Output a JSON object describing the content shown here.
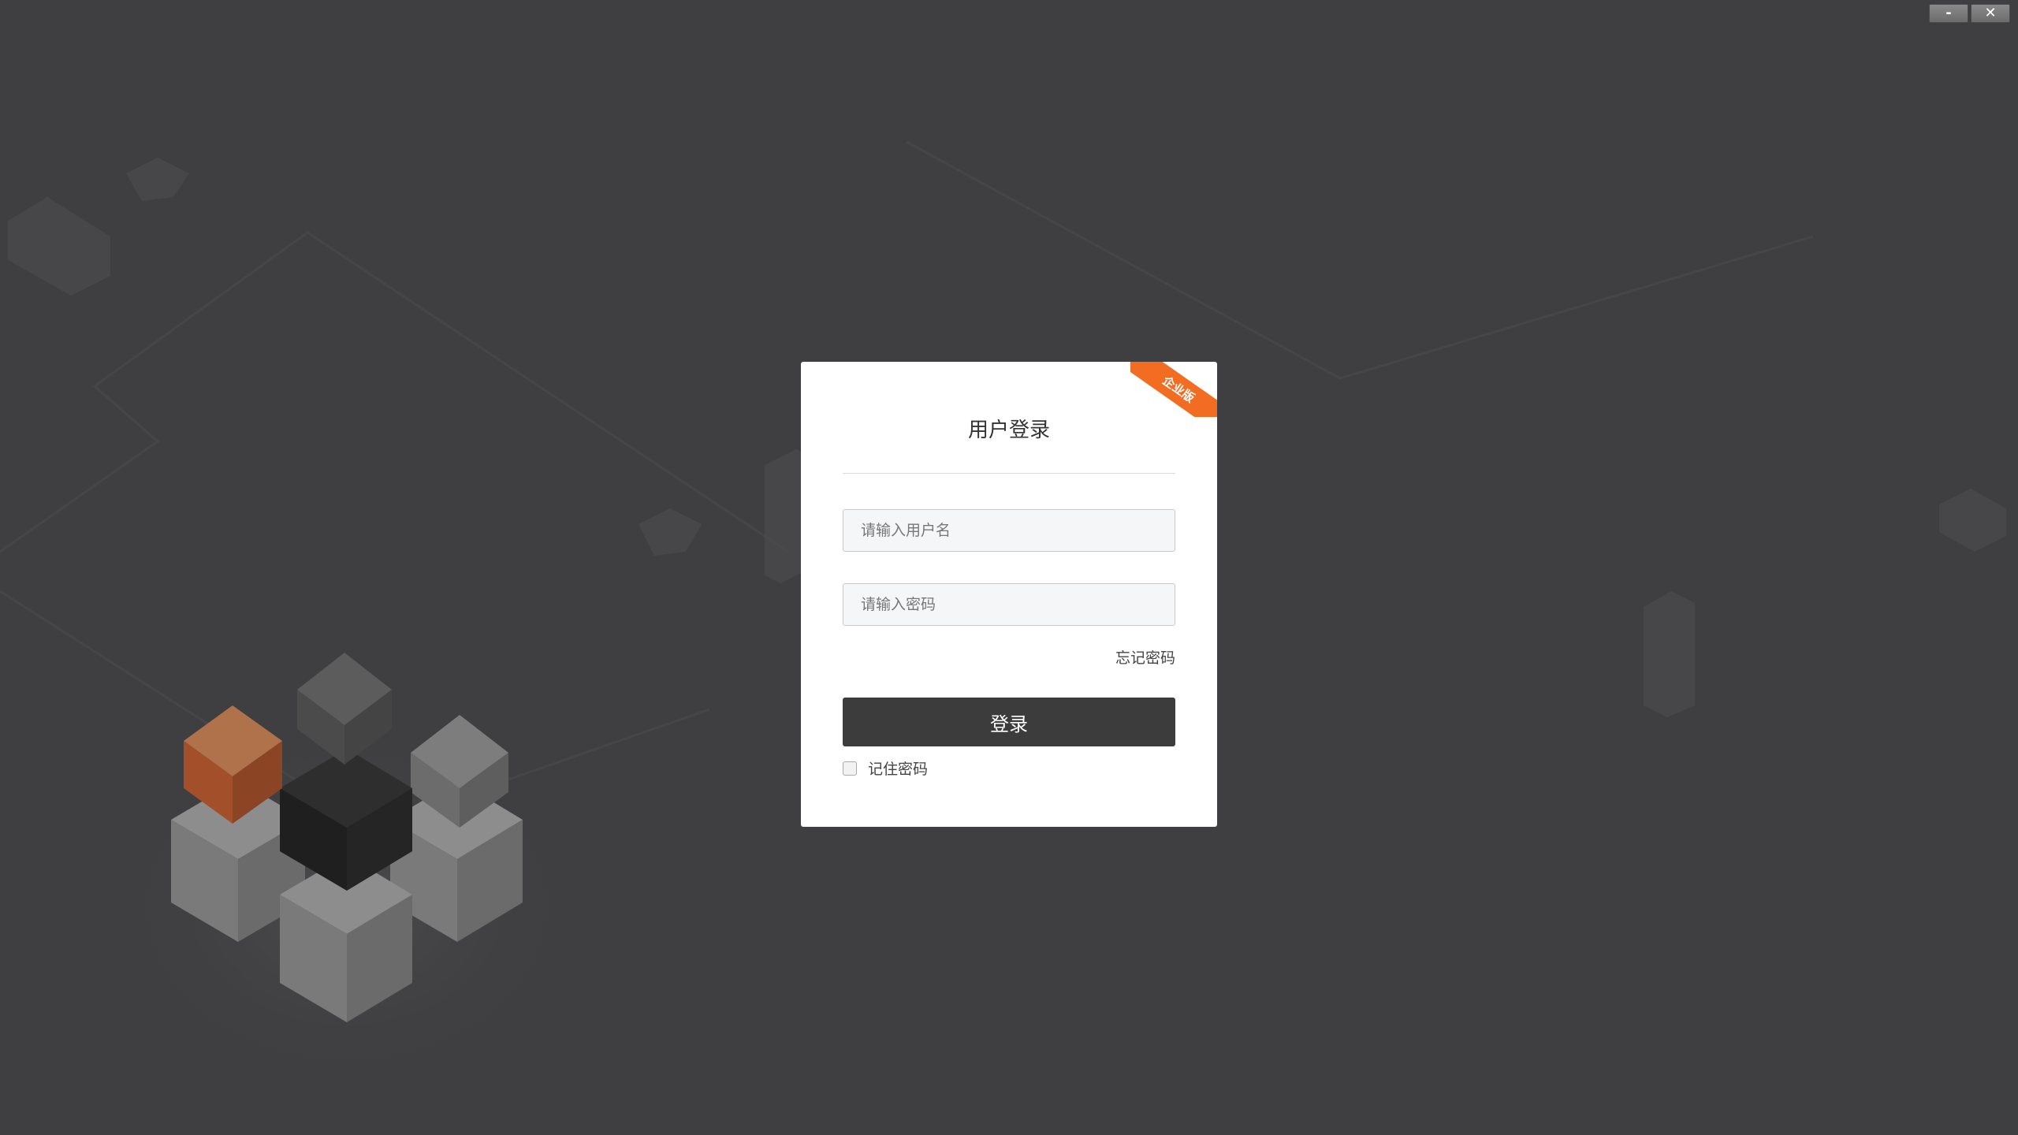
{
  "window": {
    "minimize_label": "-",
    "close_label": "✕"
  },
  "login": {
    "badge": "企业版",
    "title": "用户登录",
    "username_placeholder": "请输入用户名",
    "password_placeholder": "请输入密码",
    "forgot_label": "忘记密码",
    "submit_label": "登录",
    "remember_label": "记住密码"
  },
  "colors": {
    "background": "#3f3f41",
    "accent": "#f26c22",
    "button": "#3c3c3c"
  }
}
